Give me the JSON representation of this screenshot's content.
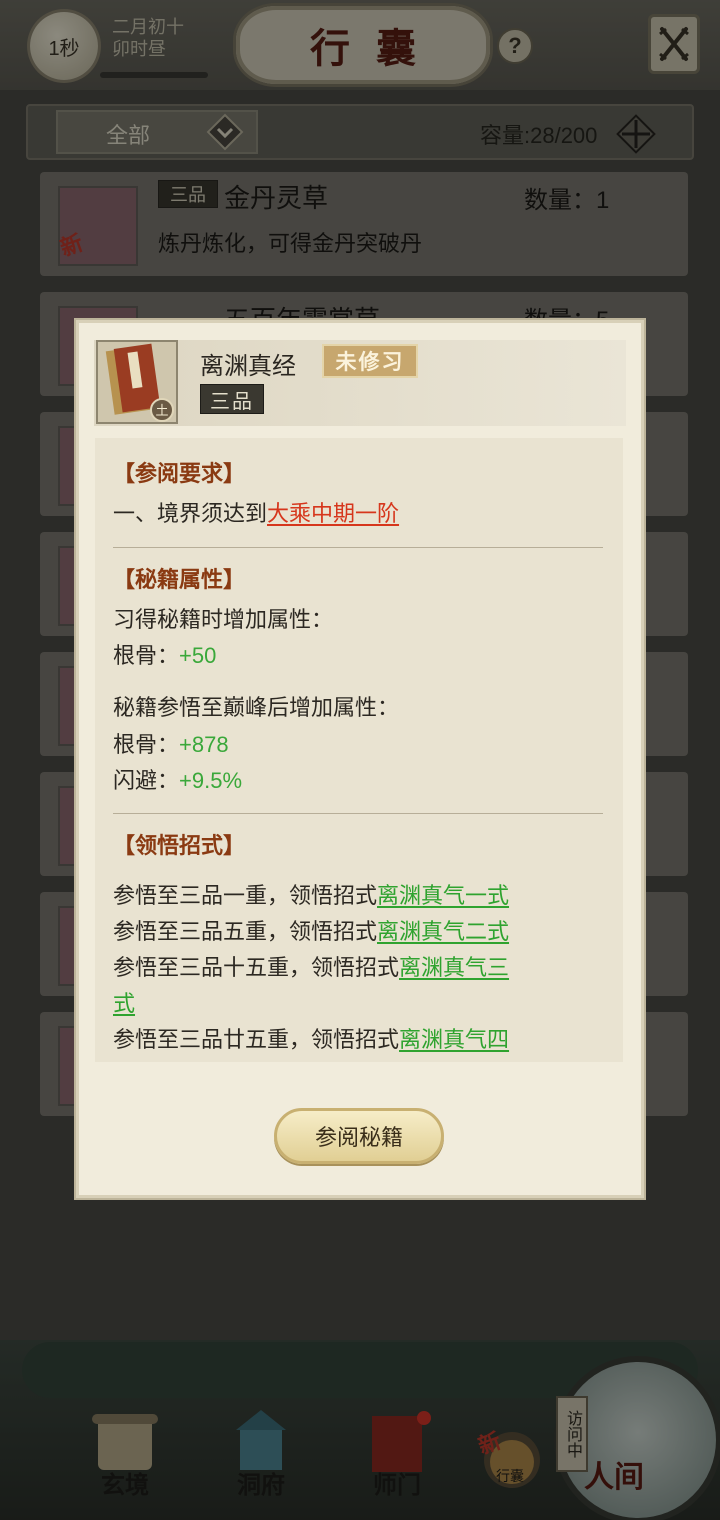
{
  "header": {
    "timer": "1秒",
    "date_line1": "二月初十",
    "date_line2": "卯时昼",
    "title": "行囊",
    "help": "?"
  },
  "filter": {
    "category": "全部",
    "capacity": "容量:28/200"
  },
  "inventory": [
    {
      "grade": "三品",
      "name": "金丹灵草",
      "qty": "数量：1",
      "desc": "炼丹炼化，可得金丹突破丹",
      "new_tag": "新"
    },
    {
      "grade": "三品",
      "name": "五百年霓裳草",
      "qty": "数量：5"
    }
  ],
  "popup": {
    "book_name": "离渊真经",
    "status": "未修习",
    "grade": "三品",
    "book_icon_tag": "土",
    "section_requirements": "【参阅要求】",
    "req_prefix": "一、境界须达到",
    "req_link": "大乘中期一阶",
    "section_attributes": "【秘籍属性】",
    "attr_learn_label": "习得秘籍时增加属性：",
    "attr_learn_stat": "根骨：",
    "attr_learn_value": "+50",
    "attr_peak_label": "秘籍参悟至巅峰后增加属性：",
    "attr_peak_stat1": "根骨：",
    "attr_peak_value1": "+878",
    "attr_peak_stat2": "闪避：",
    "attr_peak_value2": "+9.5%",
    "section_moves": "【领悟招式】",
    "moves": [
      {
        "prefix": "参悟至三品一重，领悟招式",
        "link": "离渊真气一式"
      },
      {
        "prefix": "参悟至三品五重，领悟招式",
        "link": "离渊真气二式"
      },
      {
        "prefix": "参悟至三品十五重，领悟招式",
        "link": "离渊真气三",
        "link_cont": "式"
      },
      {
        "prefix": "参悟至三品廿五重，领悟招式",
        "link": "离渊真气四"
      }
    ],
    "read_button": "参阅秘籍"
  },
  "bottom_nav": {
    "items": [
      "玄境",
      "洞府",
      "师门",
      "行囊"
    ],
    "bag_new_tag": "新",
    "world": "人间",
    "visiting": "访问中"
  },
  "colors": {
    "accent_red": "#d6361c",
    "accent_green": "#3aa83a",
    "section_brown": "#8a3a12"
  }
}
